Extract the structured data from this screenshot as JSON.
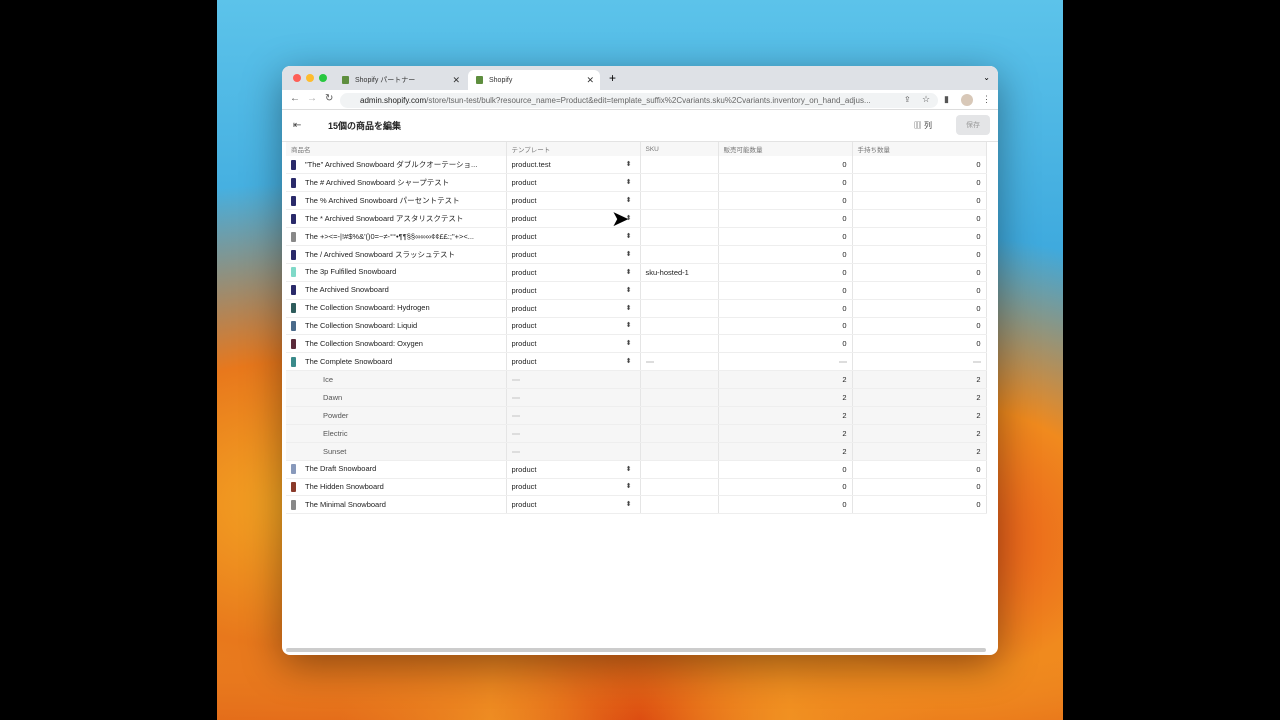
{
  "browser": {
    "tabs": [
      {
        "label": "Shopify パートナー"
      },
      {
        "label": "Shopify"
      }
    ],
    "url_host": "admin.shopify.com",
    "url_path": "/store/tsun-test/bulk?resource_name=Product&edit=template_suffix%2Cvariants.sku%2Cvariants.inventory_on_hand_adjus..."
  },
  "header": {
    "title": "15個の商品を編集",
    "columns_label": "列",
    "save_label": "保存"
  },
  "table": {
    "headers": [
      "商品名",
      "テンプレート",
      "SKU",
      "販売可能数量",
      "手持ち数量"
    ],
    "rows": [
      {
        "name": "\"The\"  Archived Snowboard ダブルクオーテーショ...",
        "template": "product.test",
        "sku": "",
        "available": "0",
        "on_hand": "0",
        "color": "#2a2a6a"
      },
      {
        "name": "The #  Archived Snowboard シャープテスト",
        "template": "product",
        "sku": "",
        "available": "0",
        "on_hand": "0",
        "color": "#2a2a6a"
      },
      {
        "name": "The %  Archived Snowboard パーセントテスト",
        "template": "product",
        "sku": "",
        "available": "0",
        "on_hand": "0",
        "color": "#2a2a6a"
      },
      {
        "name": "The *  Archived Snowboard アスタリスクテスト",
        "template": "product",
        "sku": "",
        "available": "0",
        "on_hand": "0",
        "color": "#2a2a6a"
      },
      {
        "name": "The +><=-|!#$%&'()0=~≠-°°•¶¶§§∞∞∞¢¢££:;\"+><...",
        "template": "product",
        "sku": "",
        "available": "0",
        "on_hand": "0",
        "color": "#888"
      },
      {
        "name": "The /  Archived Snowboard スラッシュテスト",
        "template": "product",
        "sku": "",
        "available": "0",
        "on_hand": "0",
        "color": "#2a2a6a"
      },
      {
        "name": "The 3p Fulfilled Snowboard",
        "template": "product",
        "sku": "sku-hosted-1",
        "available": "0",
        "on_hand": "0",
        "color": "#7fd9c8"
      },
      {
        "name": "The Archived Snowboard",
        "template": "product",
        "sku": "",
        "available": "0",
        "on_hand": "0",
        "color": "#2a2a6a"
      },
      {
        "name": "The Collection Snowboard: Hydrogen",
        "template": "product",
        "sku": "",
        "available": "0",
        "on_hand": "0",
        "color": "#2e5c5c"
      },
      {
        "name": "The Collection Snowboard: Liquid",
        "template": "product",
        "sku": "",
        "available": "0",
        "on_hand": "0",
        "color": "#4a6a8a"
      },
      {
        "name": "The Collection Snowboard: Oxygen",
        "template": "product",
        "sku": "",
        "available": "0",
        "on_hand": "0",
        "color": "#5a2a3a"
      },
      {
        "name": "The Complete Snowboard",
        "template": "product",
        "sku": "-",
        "available": "-",
        "on_hand": "-",
        "color": "#3a8a8a"
      },
      {
        "variant": true,
        "name": "Ice",
        "available": "2",
        "on_hand": "2"
      },
      {
        "variant": true,
        "name": "Dawn",
        "available": "2",
        "on_hand": "2"
      },
      {
        "variant": true,
        "name": "Powder",
        "available": "2",
        "on_hand": "2"
      },
      {
        "variant": true,
        "name": "Electric",
        "available": "2",
        "on_hand": "2"
      },
      {
        "variant": true,
        "name": "Sunset",
        "available": "2",
        "on_hand": "2"
      },
      {
        "name": "The Draft Snowboard",
        "template": "product",
        "sku": "",
        "available": "0",
        "on_hand": "0",
        "color": "#8899bb"
      },
      {
        "name": "The Hidden Snowboard",
        "template": "product",
        "sku": "",
        "available": "0",
        "on_hand": "0",
        "color": "#8a3a2a"
      },
      {
        "name": "The Minimal Snowboard",
        "template": "product",
        "sku": "",
        "available": "0",
        "on_hand": "0",
        "color": "#888"
      }
    ]
  }
}
